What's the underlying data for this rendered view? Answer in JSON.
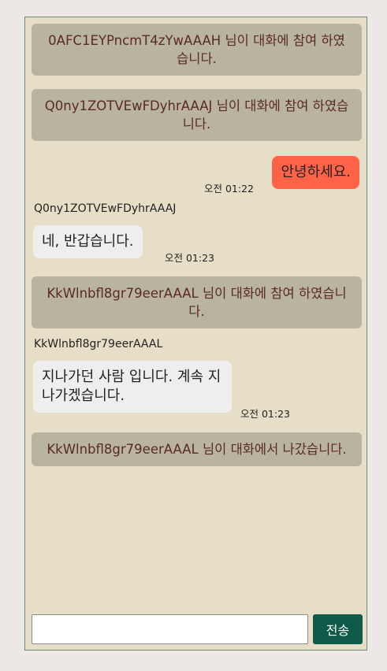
{
  "messages": [
    {
      "kind": "system",
      "text": "0AFC1EYPncmT4zYwAAAH 님이 대화에 참여 하였습니다."
    },
    {
      "kind": "system",
      "text": "Q0ny1ZOTVEwFDyhrAAAJ 님이 대화에 참여 하였습니다."
    },
    {
      "kind": "mine",
      "text": "안녕하세요.",
      "time": "오전 01:22"
    },
    {
      "kind": "other",
      "sender": "Q0ny1ZOTVEwFDyhrAAAJ",
      "text": "네, 반갑습니다.",
      "time": "오전 01:23"
    },
    {
      "kind": "system",
      "text": "KkWlnbfl8gr79eerAAAL 님이 대화에 참여 하였습니다."
    },
    {
      "kind": "other",
      "sender": "KkWlnbfl8gr79eerAAAL",
      "text": "지나가던 사람 입니다. 계속 지나가겠습니다.",
      "time": "오전 01:23"
    },
    {
      "kind": "system",
      "text": "KkWlnbfl8gr79eerAAAL 님이 대화에서 나갔습니다."
    }
  ],
  "input": {
    "value": "",
    "placeholder": ""
  },
  "send_label": "전송",
  "colors": {
    "page_bg": "#ede8e6",
    "chat_bg": "#e7dec7",
    "system_bg": "#b9b4a0",
    "system_text": "#5c2a1e",
    "my_bubble": "#ff6347",
    "other_bubble": "#eeeeee",
    "send_button": "#105a4a"
  }
}
